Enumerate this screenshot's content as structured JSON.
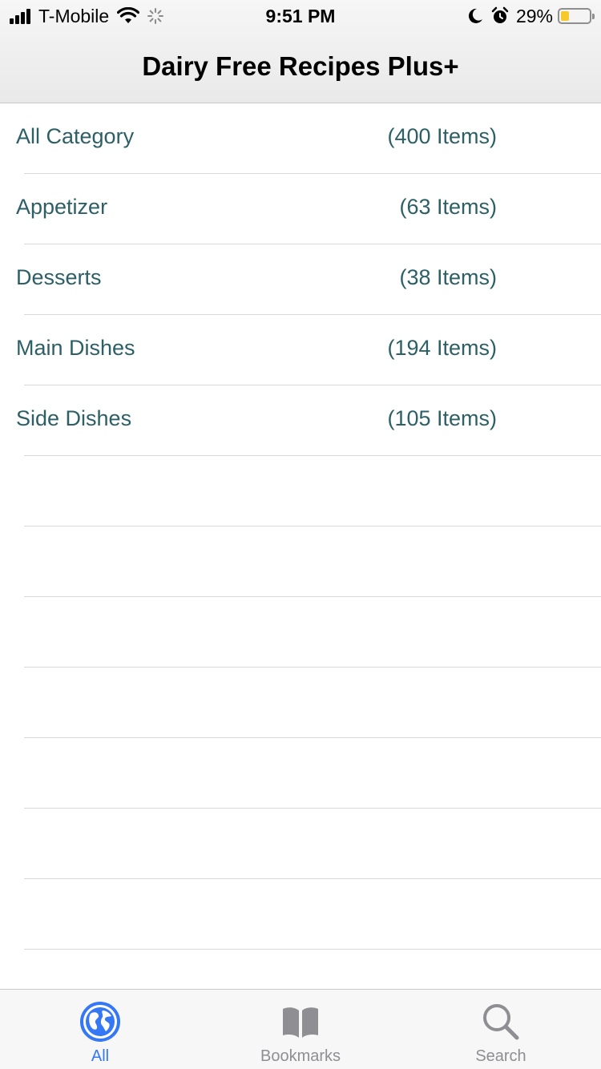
{
  "status_bar": {
    "carrier": "T-Mobile",
    "time": "9:51 PM",
    "battery": "29%",
    "battery_level": 0.29,
    "icons": [
      "signal-icon",
      "wifi-icon",
      "activity-spinner-icon",
      "moon-icon",
      "alarm-icon",
      "battery-icon"
    ]
  },
  "nav": {
    "title": "Dairy Free Recipes Plus+"
  },
  "categories": [
    {
      "name": "All Category",
      "count": "(400 Items)"
    },
    {
      "name": "Appetizer",
      "count": "(63 Items)"
    },
    {
      "name": "Desserts",
      "count": "(38 Items)"
    },
    {
      "name": "Main Dishes",
      "count": "(194 Items)"
    },
    {
      "name": "Side Dishes",
      "count": "(105 Items)"
    }
  ],
  "tabs": [
    {
      "label": "All",
      "icon": "globe-icon",
      "active": true
    },
    {
      "label": "Bookmarks",
      "icon": "book-icon",
      "active": false
    },
    {
      "label": "Search",
      "icon": "search-icon",
      "active": false
    }
  ],
  "colors": {
    "list_text": "#2c5f66",
    "tab_active": "#3478f6",
    "tab_inactive": "#8e8e93",
    "battery_fill": "#f6c829"
  }
}
